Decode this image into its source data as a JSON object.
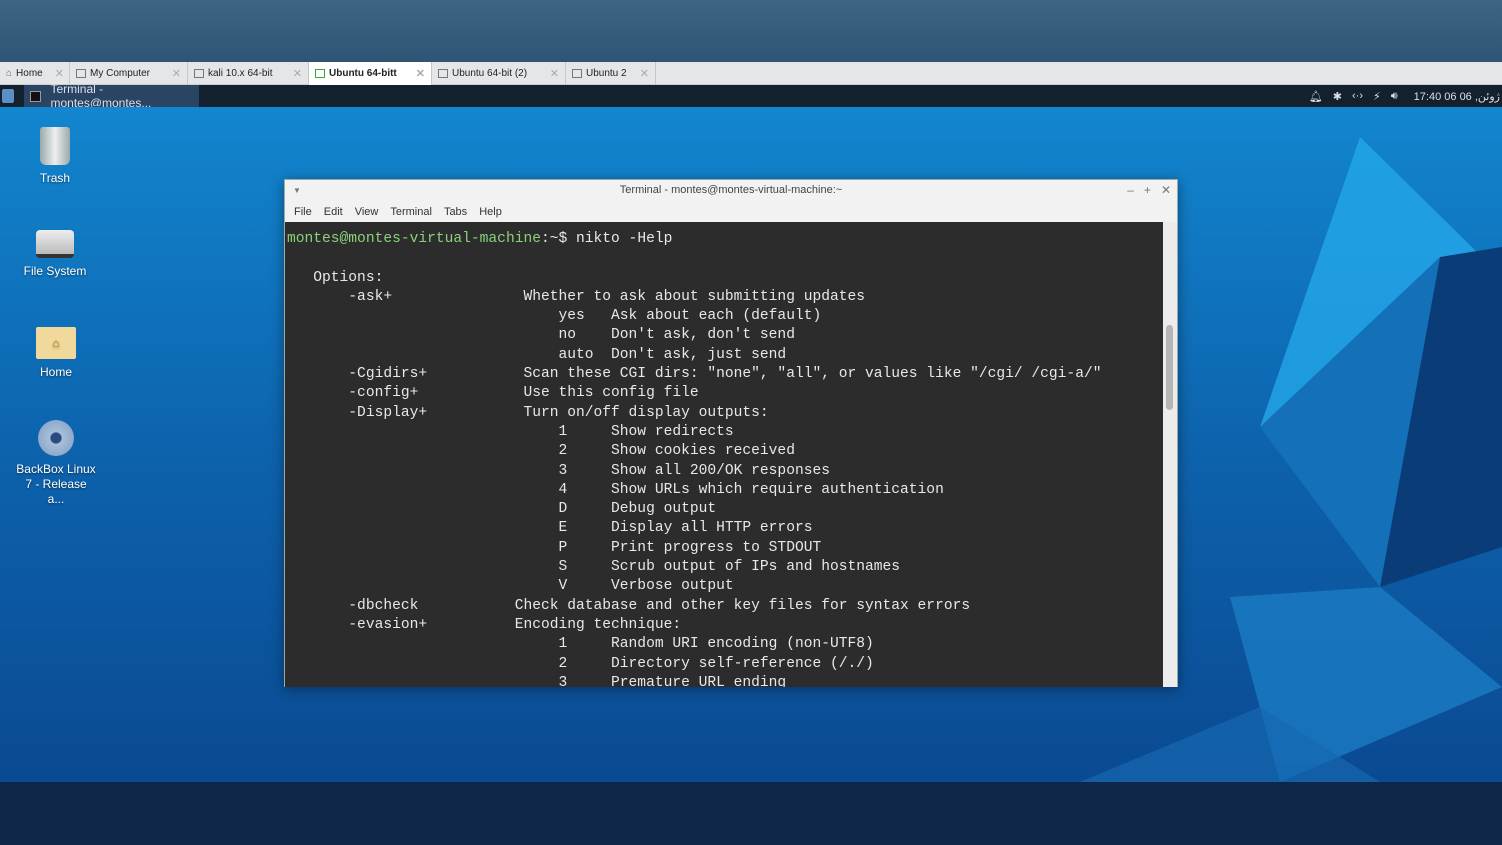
{
  "vm_tabs": [
    {
      "label": "Home",
      "icon": "home-icon"
    },
    {
      "label": "My Computer",
      "icon": "computer-icon"
    },
    {
      "label": "kali 10.x 64-bit",
      "icon": "vm-icon"
    },
    {
      "label": "Ubuntu 64-bitt",
      "icon": "vm-running-icon",
      "active": true
    },
    {
      "label": "Ubuntu 64-bit (2)",
      "icon": "vm-icon"
    },
    {
      "label": "Ubuntu 2",
      "icon": "vm-icon"
    }
  ],
  "taskbar": {
    "window_label": "Terminal - montes@montes...",
    "clock": "17:40",
    "date": "06 ژوئن,"
  },
  "desktop_icons": [
    {
      "label": "Trash"
    },
    {
      "label": "File System"
    },
    {
      "label": "Home"
    },
    {
      "label": "BackBox Linux 7 - Release a..."
    }
  ],
  "terminal": {
    "title": "Terminal - montes@montes-virtual-machine:~",
    "menu": [
      "File",
      "Edit",
      "View",
      "Terminal",
      "Tabs",
      "Help"
    ],
    "prompt_user": "montes@montes-virtual-machine",
    "prompt_rest": ":~$ ",
    "command": "nikto -Help",
    "lines": [
      "",
      "   Options:",
      "       -ask+               Whether to ask about submitting updates",
      "                               yes   Ask about each (default)",
      "                               no    Don't ask, don't send",
      "                               auto  Don't ask, just send",
      "       -Cgidirs+           Scan these CGI dirs: \"none\", \"all\", or values like \"/cgi/ /cgi-a/\"",
      "       -config+            Use this config file",
      "       -Display+           Turn on/off display outputs:",
      "                               1     Show redirects",
      "                               2     Show cookies received",
      "                               3     Show all 200/OK responses",
      "                               4     Show URLs which require authentication",
      "                               D     Debug output",
      "                               E     Display all HTTP errors",
      "                               P     Print progress to STDOUT",
      "                               S     Scrub output of IPs and hostnames",
      "                               V     Verbose output",
      "       -dbcheck           Check database and other key files for syntax errors",
      "       -evasion+          Encoding technique:",
      "                               1     Random URI encoding (non-UTF8)",
      "                               2     Directory self-reference (/./)",
      "                               3     Premature URL ending"
    ]
  }
}
